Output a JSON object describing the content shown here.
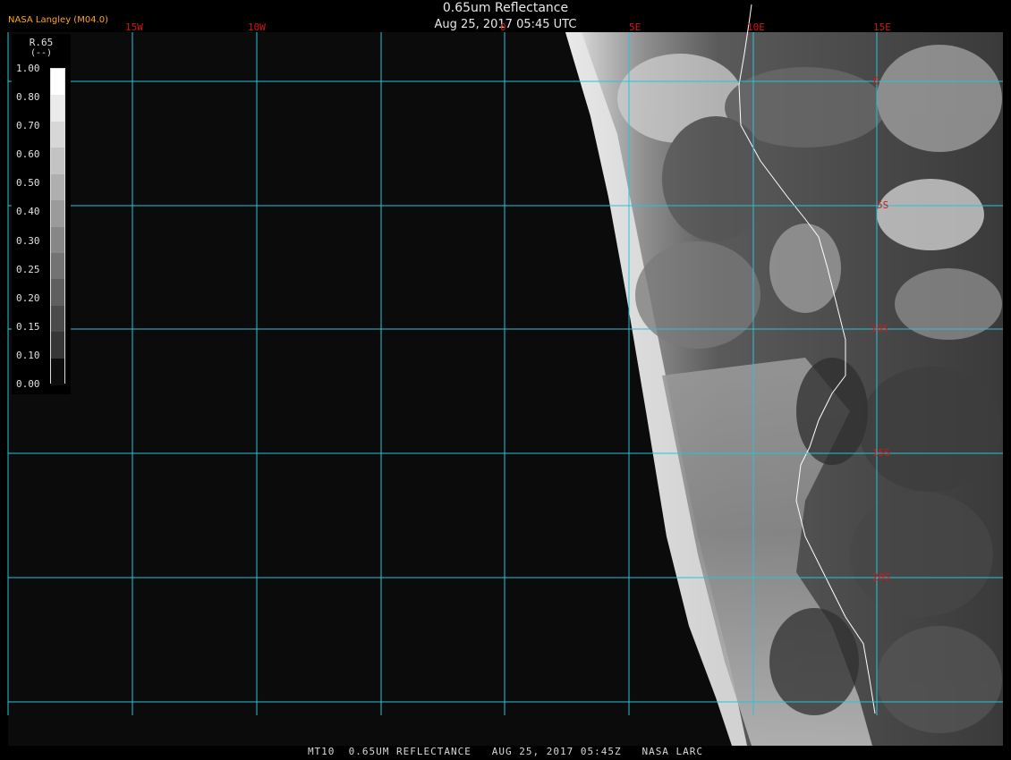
{
  "header": {
    "title": "0.65um Reflectance",
    "datetime": "Aug 25, 2017 05:45 UTC",
    "provider": "NASA Langley (M04.0)"
  },
  "grid": {
    "longitude_labels": [
      "15W",
      "10W",
      "5W",
      "0",
      "5E",
      "10E",
      "15E"
    ],
    "latitude_labels": [
      "0",
      "5S",
      "10S",
      "15S",
      "20S"
    ],
    "line_color": "#27c3d6"
  },
  "legend": {
    "title": "R.65",
    "units": "(--)",
    "ticks": [
      "1.00",
      "0.80",
      "0.70",
      "0.60",
      "0.50",
      "0.40",
      "0.30",
      "0.25",
      "0.20",
      "0.15",
      "0.10",
      "0.00"
    ],
    "colors": [
      "#ffffff",
      "#ebebeb",
      "#d7d7d7",
      "#c3c3c3",
      "#afafaf",
      "#9b9b9b",
      "#878787",
      "#737373",
      "#5f5f5f",
      "#4b4b4b",
      "#373737",
      "#0d0d0d"
    ]
  },
  "footer": {
    "text": "MT10  0.65UM REFLECTANCE   AUG 25, 2017 05:45Z   NASA LARC"
  }
}
